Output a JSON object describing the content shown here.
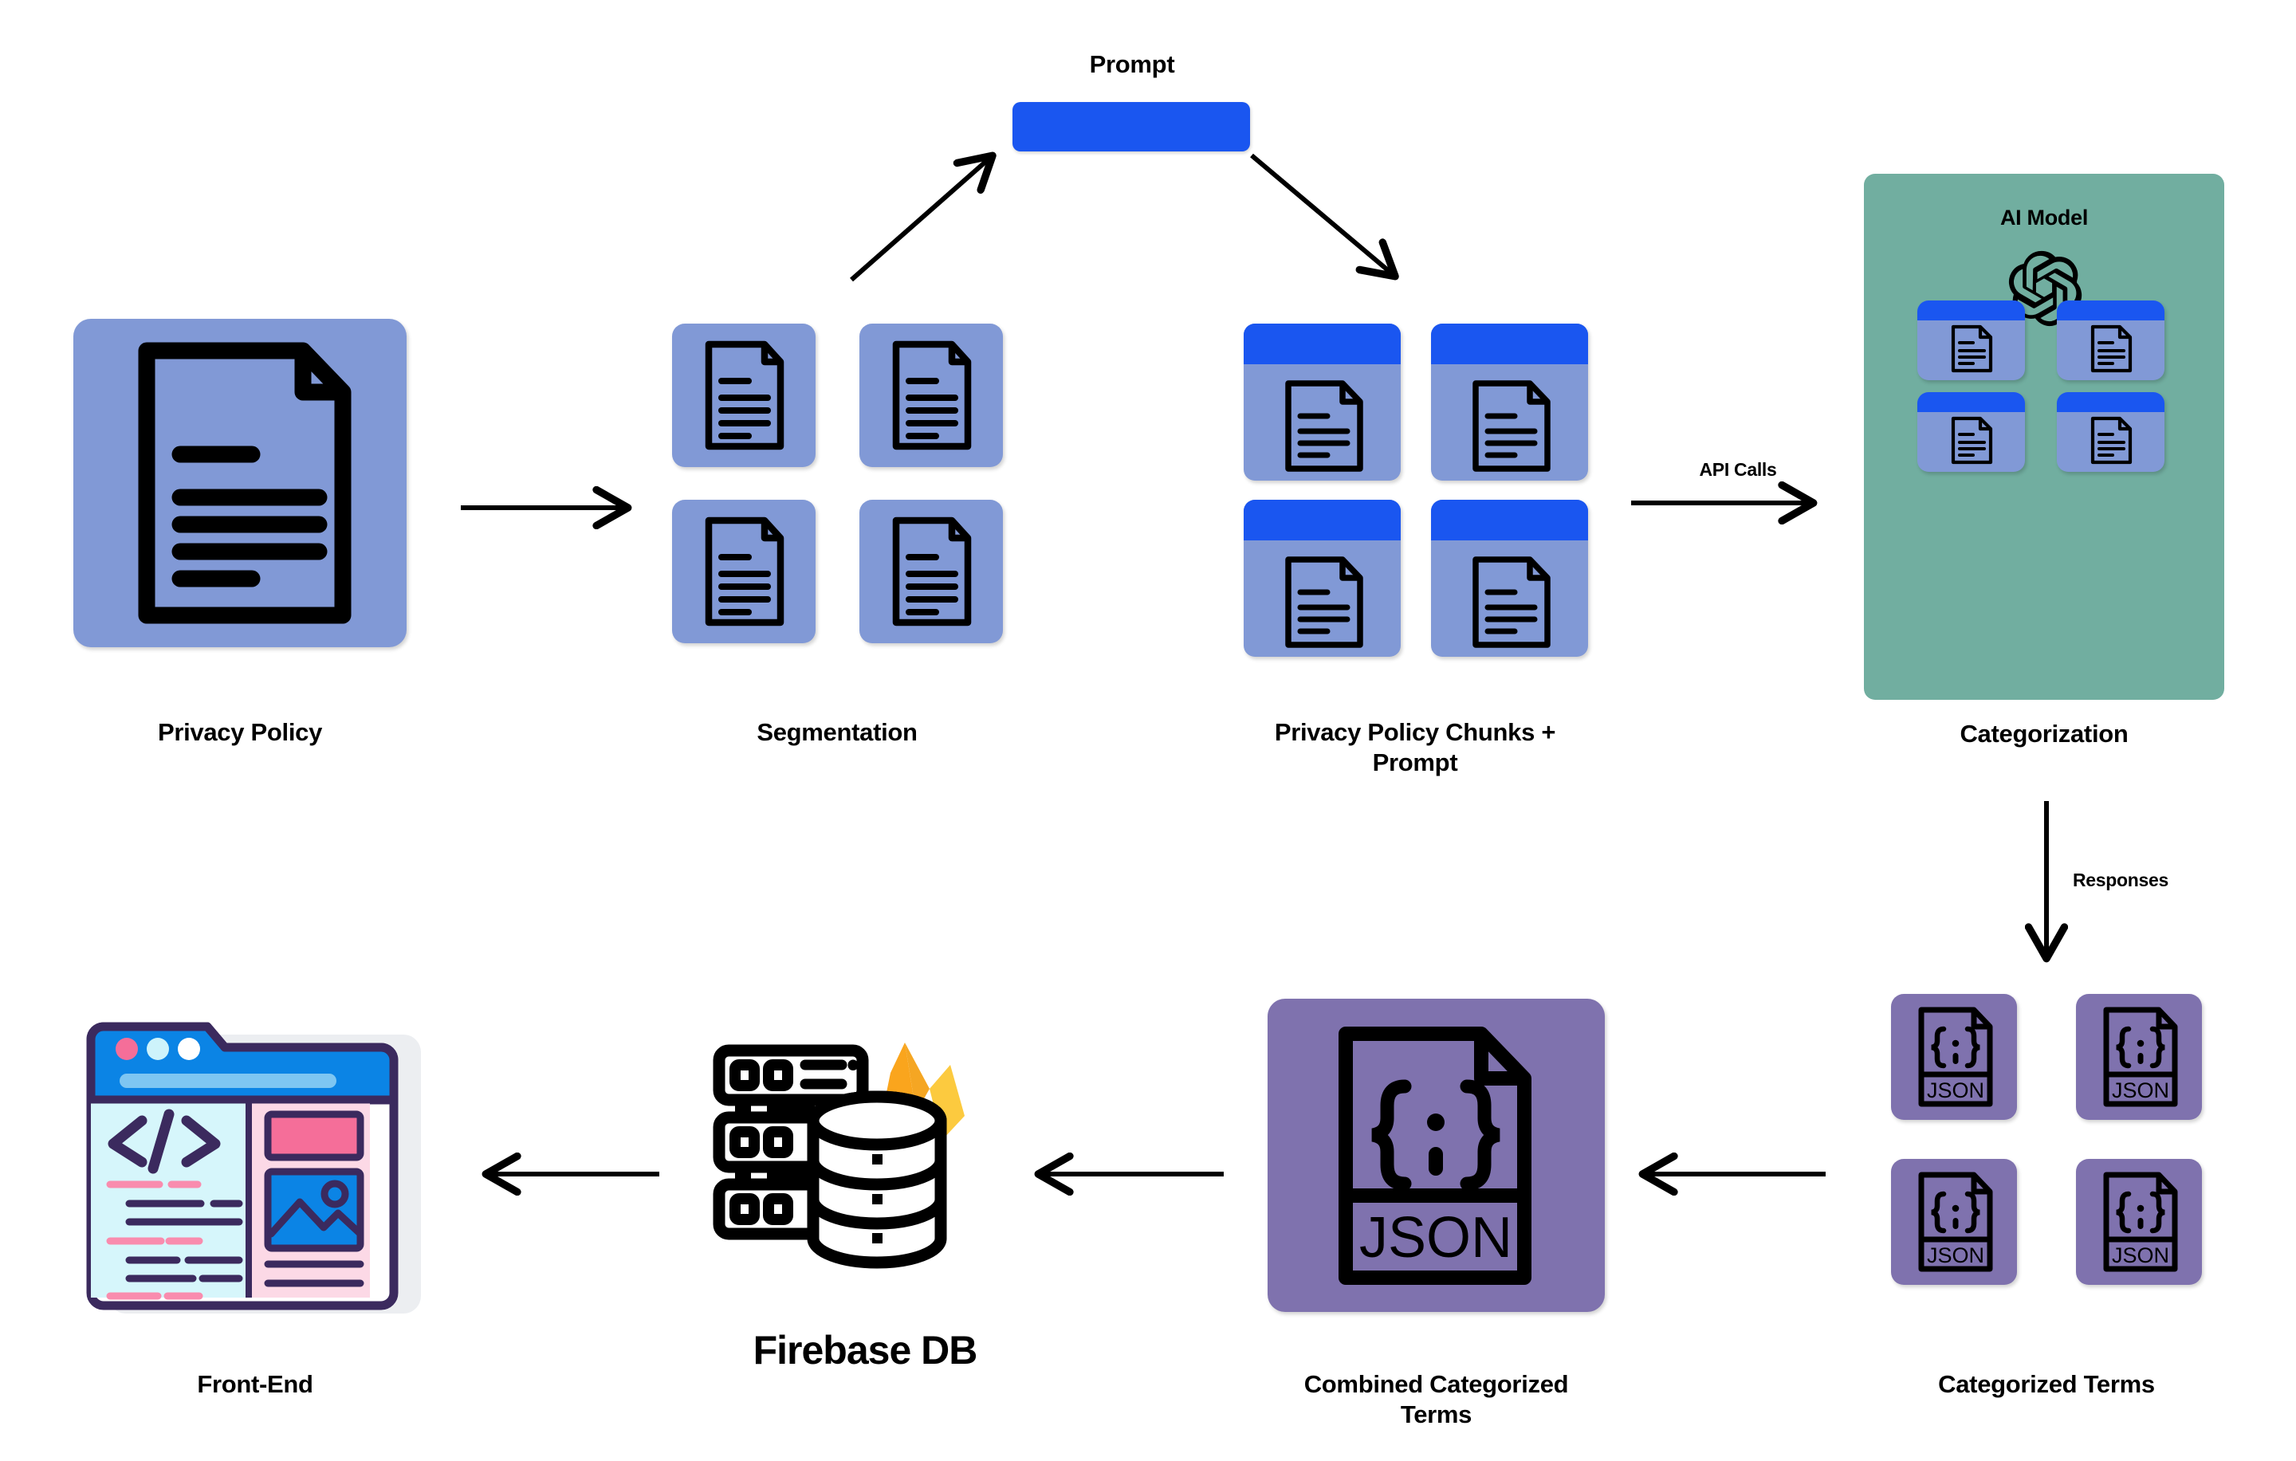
{
  "diagram": {
    "title_text_present": false,
    "colors": {
      "card_blue": "#8199d6",
      "header_blue": "#1a56f0",
      "panel_green": "#71aea0",
      "json_purple": "#7f72ae",
      "arrow_black": "#000000",
      "firebase_orange": "#f7a329",
      "firebase_yellow": "#fcca3f",
      "frontend_navy": "#3b2a5e",
      "frontend_blue": "#0b84e5",
      "frontend_pink": "#f56e99",
      "frontend_lightpink": "#fcd9e6",
      "frontend_cyan": "#d6f6fb"
    },
    "nodes": [
      {
        "id": "privacy-policy",
        "label": "Privacy Policy",
        "icon": "document-icon"
      },
      {
        "id": "segmentation",
        "label": "Segmentation",
        "icon": "document-grid-icon"
      },
      {
        "id": "chunks-prompt",
        "label": "Privacy Policy Chunks + Prompt",
        "icon": "document-chunk-grid-icon"
      },
      {
        "id": "categorization",
        "label": "Categorization",
        "icon": "openai-logo-icon"
      },
      {
        "id": "categorized-terms",
        "label": "Categorized Terms",
        "icon": "json-file-grid-icon"
      },
      {
        "id": "combined-terms",
        "label": "Combined Categorized Terms",
        "icon": "json-file-icon"
      },
      {
        "id": "firebase-db",
        "label": "Firebase DB",
        "icon": "database-server-icon"
      },
      {
        "id": "front-end",
        "label": "Front-End",
        "icon": "browser-code-icon"
      }
    ],
    "inline_labels": {
      "prompt": "Prompt",
      "ai_model": "AI Model"
    },
    "edge_labels": {
      "api_calls": "API Calls",
      "responses": "Responses"
    },
    "json_badge_text": "JSON",
    "code_badge_text": "</>",
    "counts": {
      "segmentation_documents": 4,
      "chunk_cards": 4,
      "categorization_cards": 4,
      "categorized_json_cards": 4
    },
    "flow": [
      {
        "from": "privacy-policy",
        "to": "segmentation",
        "label": ""
      },
      {
        "from": "segmentation",
        "to": "prompt",
        "label": ""
      },
      {
        "from": "prompt",
        "to": "chunks-prompt",
        "label": ""
      },
      {
        "from": "chunks-prompt",
        "to": "categorization",
        "label": "API Calls"
      },
      {
        "from": "categorization",
        "to": "categorized-terms",
        "label": "Responses"
      },
      {
        "from": "categorized-terms",
        "to": "combined-terms",
        "label": ""
      },
      {
        "from": "combined-terms",
        "to": "firebase-db",
        "label": ""
      },
      {
        "from": "firebase-db",
        "to": "front-end",
        "label": ""
      }
    ]
  }
}
